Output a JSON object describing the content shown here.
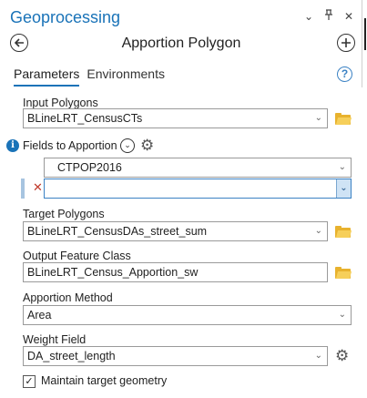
{
  "pane": {
    "title": "Geoprocessing",
    "titlebar_icons": [
      "chevron-down-icon",
      "pin-icon",
      "close-icon"
    ]
  },
  "tool": {
    "title": "Apportion Polygon",
    "back_icon": "back-arrow-icon",
    "add_icon": "add-icon"
  },
  "tabs": [
    {
      "label": "Parameters",
      "active": true
    },
    {
      "label": "Environments",
      "active": false
    }
  ],
  "params": {
    "input_polygons": {
      "label": "Input Polygons",
      "value": "BLineLRT_CensusCTs"
    },
    "fields_to_apportion": {
      "label": "Fields to Apportion",
      "rows": [
        "CTPOP2016",
        ""
      ]
    },
    "target_polygons": {
      "label": "Target Polygons",
      "value": "BLineLRT_CensusDAs_street_sum"
    },
    "output_feature_class": {
      "label": "Output Feature Class",
      "value": "BLineLRT_Census_Apportion_sw"
    },
    "apportion_method": {
      "label": "Apportion Method",
      "value": "Area"
    },
    "weight_field": {
      "label": "Weight Field",
      "value": "DA_street_length"
    },
    "maintain_geometry": {
      "label": "Maintain target geometry",
      "checked": true
    }
  },
  "colors": {
    "accent": "#1a73b8",
    "folder": "#e8b22e",
    "remove_x": "#c0392b"
  }
}
